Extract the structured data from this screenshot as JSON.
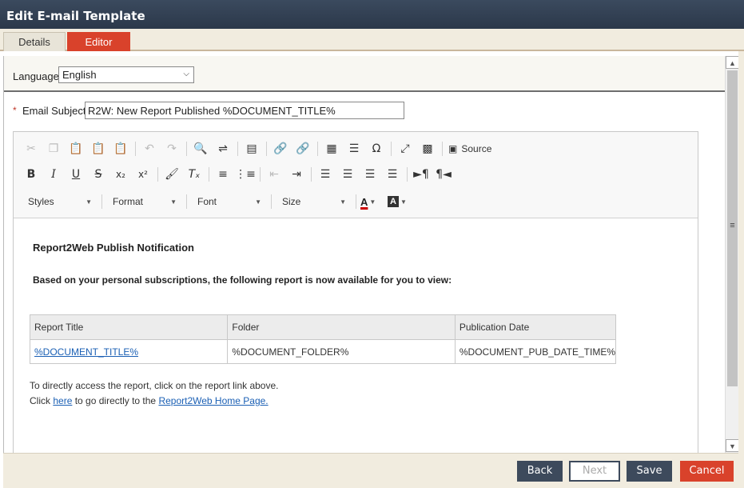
{
  "window": {
    "title": "Edit E-mail Template"
  },
  "tabs": [
    {
      "label": "Details",
      "active": false
    },
    {
      "label": "Editor",
      "active": true
    }
  ],
  "language": {
    "label": "Language",
    "value": "English"
  },
  "subject": {
    "required_mark": "*",
    "label": "Email Subject",
    "value": "R2W: New Report Published %DOCUMENT_TITLE%"
  },
  "toolbar": {
    "source_label": "Source",
    "styles_label": "Styles",
    "format_label": "Format",
    "font_label": "Font",
    "size_label": "Size"
  },
  "document": {
    "title": "Report2Web Publish Notification",
    "intro": "Based on your personal subscriptions, the following report is now available for you to view:",
    "table": {
      "headers": [
        "Report Title",
        "Folder",
        "Publication Date"
      ],
      "row": [
        "%DOCUMENT_TITLE%",
        "%DOCUMENT_FOLDER%",
        "%DOCUMENT_PUB_DATE_TIME%"
      ]
    },
    "line1": "To directly access the report, click on the report link above.",
    "line2_prefix": "Click ",
    "line2_link": "here",
    "line2_mid": " to go directly to the ",
    "line2_link2": "Report2Web Home Page."
  },
  "footer": {
    "back": "Back",
    "next": "Next",
    "save": "Save",
    "cancel": "Cancel"
  },
  "colors": {
    "accent": "#d9422b",
    "primary_button": "#3d4a5c",
    "titlebar": "#2b384a",
    "tabstrip_bg": "#f1ecdf",
    "link": "#1a5fb4"
  }
}
